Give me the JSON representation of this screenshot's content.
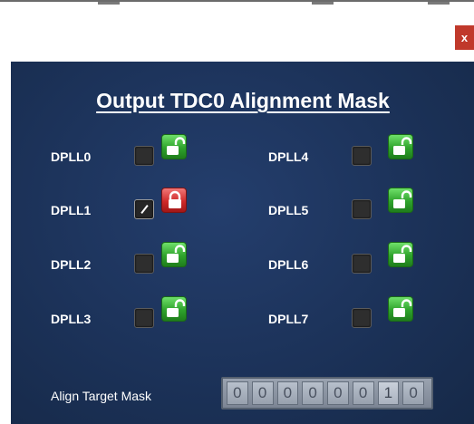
{
  "window": {
    "close_label": "x"
  },
  "panel": {
    "title": "Output TDC0 Alignment Mask"
  },
  "dplls": [
    {
      "label": "DPLL0",
      "checked": false,
      "lock": "unlocked"
    },
    {
      "label": "DPLL1",
      "checked": true,
      "lock": "locked"
    },
    {
      "label": "DPLL2",
      "checked": false,
      "lock": "unlocked"
    },
    {
      "label": "DPLL3",
      "checked": false,
      "lock": "unlocked"
    },
    {
      "label": "DPLL4",
      "checked": false,
      "lock": "unlocked"
    },
    {
      "label": "DPLL5",
      "checked": false,
      "lock": "unlocked"
    },
    {
      "label": "DPLL6",
      "checked": false,
      "lock": "unlocked"
    },
    {
      "label": "DPLL7",
      "checked": false,
      "lock": "unlocked"
    }
  ],
  "align_target": {
    "label": "Align Target Mask",
    "bits": [
      "0",
      "0",
      "0",
      "0",
      "0",
      "0",
      "1",
      "0"
    ]
  },
  "colors": {
    "panel_bg": "#1b3157",
    "close_bg": "#c0392b",
    "unlocked": "#2fa32c",
    "locked": "#cf2a2a"
  },
  "icons": {
    "unlocked": "unlocked-padlock-icon",
    "locked": "locked-padlock-icon"
  }
}
